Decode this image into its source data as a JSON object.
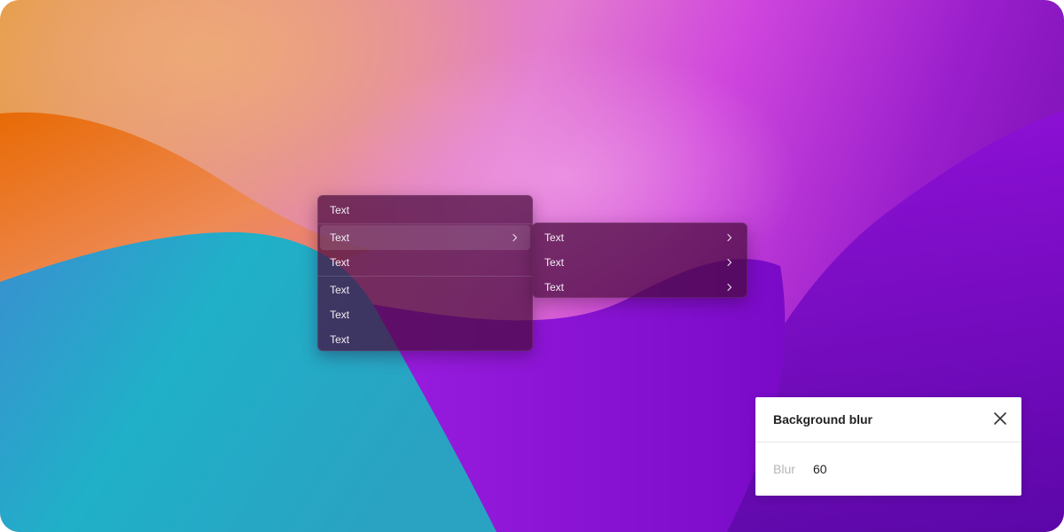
{
  "menu": {
    "items": [
      {
        "label": "Text"
      },
      {
        "label": "Text",
        "submenu": true
      },
      {
        "label": "Text"
      },
      {
        "label": "Text"
      },
      {
        "label": "Text"
      },
      {
        "label": "Text"
      }
    ]
  },
  "submenu": {
    "items": [
      {
        "label": "Text"
      },
      {
        "label": "Text"
      },
      {
        "label": "Text"
      }
    ]
  },
  "panel": {
    "title": "Background blur",
    "field_label": "Blur",
    "field_value": "60",
    "close_icon": "close-icon"
  },
  "icons": {
    "chevron": "chevron-right-icon"
  },
  "colors": {
    "menu_bg": "#480a3c",
    "panel_bg": "#ffffff"
  }
}
